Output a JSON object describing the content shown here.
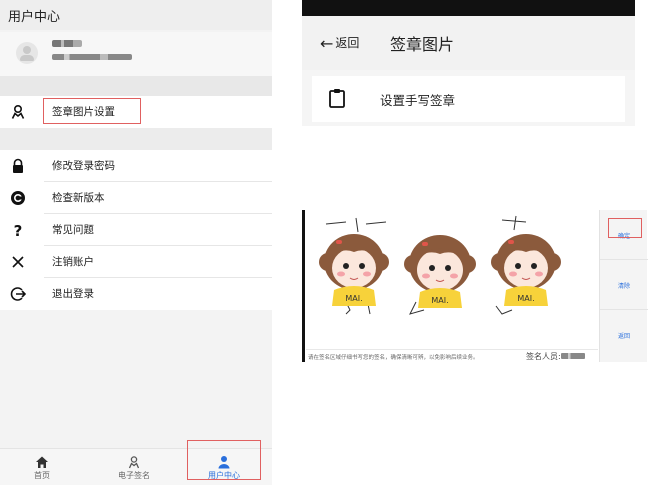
{
  "user_center": {
    "title": "用户中心",
    "menu": [
      {
        "label": "签章图片设置",
        "icon": "person-badge-icon"
      },
      {
        "label": "修改登录密码",
        "icon": "lock-icon"
      },
      {
        "label": "检查新版本",
        "icon": "update-icon"
      },
      {
        "label": "常见问题",
        "icon": "question-icon"
      },
      {
        "label": "注销账户",
        "icon": "close-icon"
      },
      {
        "label": "退出登录",
        "icon": "logout-icon"
      }
    ],
    "tabs": [
      {
        "label": "首页",
        "icon": "home-icon"
      },
      {
        "label": "电子签名",
        "icon": "signature-icon"
      },
      {
        "label": "用户中心",
        "icon": "user-icon"
      }
    ]
  },
  "signature_page": {
    "back_label": "返回",
    "title": "签章图片",
    "set_handwritten": "设置手写签章"
  },
  "signature_pad": {
    "buttons": {
      "confirm": "确定",
      "clear": "清除",
      "back": "返回"
    },
    "tip": "请在签名区域仔细书写您的签名，确保清晰可辨，以免影响后续业务。",
    "signer_label": "签名人员:",
    "shirt_text": "MAI."
  },
  "colors": {
    "accent": "#2a6fdc",
    "highlight": "#e06060"
  }
}
